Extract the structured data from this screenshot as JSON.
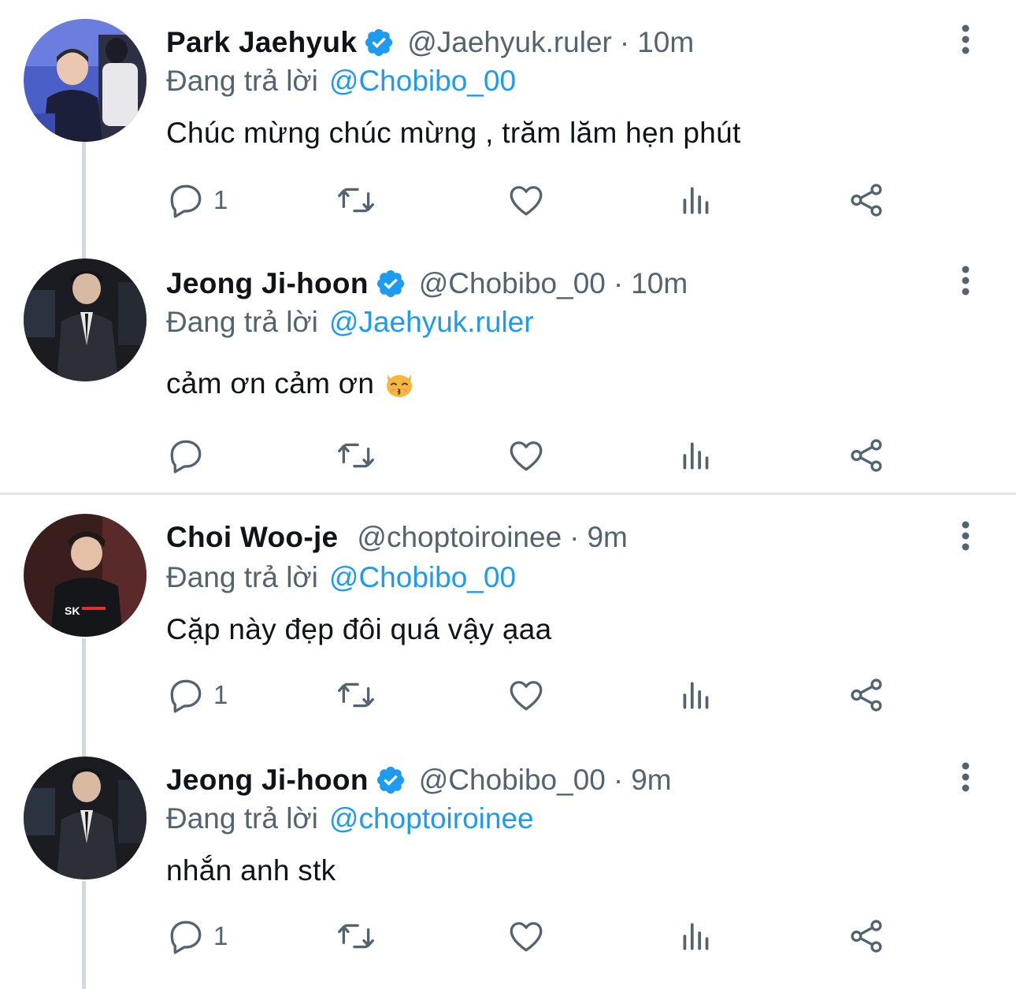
{
  "reply_prefix": "Đang trả lời",
  "tweets": [
    {
      "name": "Park Jaehyuk",
      "verified": true,
      "handle": "@Jaehyuk.ruler",
      "separator": "·",
      "time": "10m",
      "reply_to": "@Chobibo_00",
      "text": "Chúc mừng chúc mừng , trăm lăm hẹn phút",
      "emoji": "",
      "reply_count": "1"
    },
    {
      "name": "Jeong Ji-hoon",
      "verified": true,
      "handle": "@Chobibo_00",
      "separator": "·",
      "time": "10m",
      "reply_to": "@Jaehyuk.ruler",
      "text": "cảm ơn cảm ơn",
      "emoji": "kissing-cat-emoji",
      "reply_count": ""
    },
    {
      "name": "Choi Woo-je",
      "verified": false,
      "handle": "@choptoiroinee",
      "separator": "·",
      "time": "9m",
      "reply_to": "@Chobibo_00",
      "text": "Cặp này đẹp đôi quá vậy ạaa",
      "emoji": "",
      "reply_count": "1"
    },
    {
      "name": "Jeong Ji-hoon",
      "verified": true,
      "handle": "@Chobibo_00",
      "separator": "·",
      "time": "9m",
      "reply_to": "@choptoiroinee",
      "text": "nhắn anh stk",
      "emoji": "",
      "reply_count": "1"
    }
  ],
  "colors": {
    "text": "#0f1419",
    "secondary": "#536471",
    "accent": "#1d9bf0",
    "thread_line": "#cfd9de"
  },
  "icons": [
    "reply-icon",
    "retweet-icon",
    "like-icon",
    "views-icon",
    "share-icon",
    "more-icon",
    "verified-badge-icon"
  ]
}
